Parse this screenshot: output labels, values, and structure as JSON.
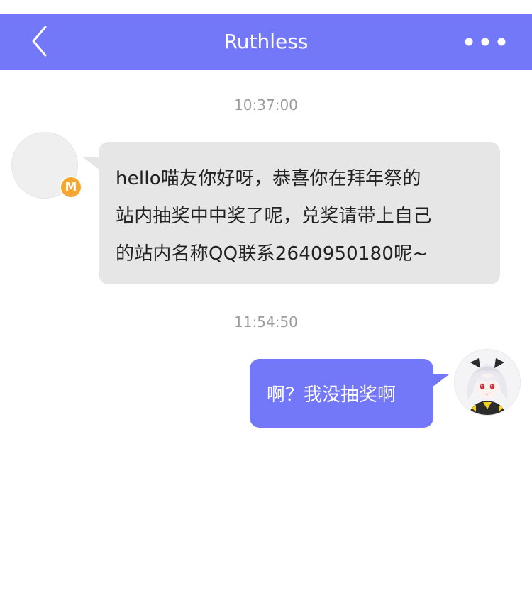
{
  "header": {
    "title": "Ruthless",
    "back_icon": "chevron-left-icon",
    "more_icon": "more-dots-icon",
    "bar_color": "#7378f8"
  },
  "messages": [
    {
      "timestamp": "10:37:00",
      "sender": "other",
      "badge": "M",
      "lines": [
        "hello喵友你好呀，恭喜你在拜年祭的",
        "站内抽奖中中奖了呢，兑奖请带上自己",
        "的站内名称QQ联系2640950180呢~"
      ]
    },
    {
      "timestamp": "11:54:50",
      "sender": "self",
      "text": "啊？我没抽奖啊"
    }
  ],
  "colors": {
    "incoming_bubble": "#e6e6e6",
    "outgoing_bubble": "#7378f8",
    "badge": "#f5a631",
    "timestamp": "#9b9b9b"
  }
}
